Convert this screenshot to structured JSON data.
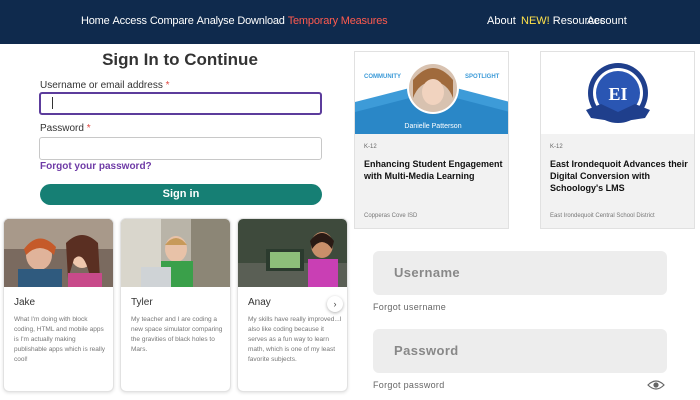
{
  "nav": {
    "left_items": [
      "Home",
      "Access",
      "Compare",
      "Analyse",
      "Download"
    ],
    "highlight_item": "Temporary Measures",
    "about": "About",
    "new_badge": "NEW!",
    "resources": "Resources",
    "account": "Account",
    "colors": {
      "bar": "#0f2a4d",
      "highlight": "#ff5a4e",
      "new": "#ffe24a"
    }
  },
  "signin": {
    "title": "Sign In to Continue",
    "username_label": "Username or email address",
    "password_label": "Password",
    "required_mark": "*",
    "username_value": "",
    "password_value": "",
    "forgot_link": "Forgot your password?",
    "submit_label": "Sign in",
    "colors": {
      "button": "#167f74",
      "link": "#6e3aa6",
      "focus": "#5c3c9c"
    }
  },
  "testimonials": [
    {
      "name": "Jake",
      "quote": "What I'm doing with block coding, HTML and mobile apps is I'm actually making publishable apps which is really cool!"
    },
    {
      "name": "Tyler",
      "quote": "My teacher and I are coding a new space simulator comparing the gravities of black holes to Mars."
    },
    {
      "name": "Anay",
      "quote": "My skills have really improved...I also like coding because it serves as a fun way to learn math, which is one of my least favorite subjects."
    }
  ],
  "carousel": {
    "next_icon": "chevron-right-icon",
    "next_glyph": "›"
  },
  "articles": [
    {
      "banner_left": "COMMUNITY",
      "banner_right": "SPOTLIGHT",
      "person": "Danielle Patterson",
      "tag": "K-12",
      "title": "Enhancing Student Engagement with Multi-Media Learning",
      "source": "Copperas Cove ISD"
    },
    {
      "logo_text": "EI",
      "tag": "K-12",
      "title": "East Irondequoit Advances their Digital Conversion with Schoology's LMS",
      "source": "East Irondequoit Central School District"
    }
  ],
  "login": {
    "username_placeholder": "Username",
    "forgot_username": "Forgot username",
    "password_placeholder": "Password",
    "forgot_password": "Forgot password",
    "eye_icon": "eye-icon"
  }
}
